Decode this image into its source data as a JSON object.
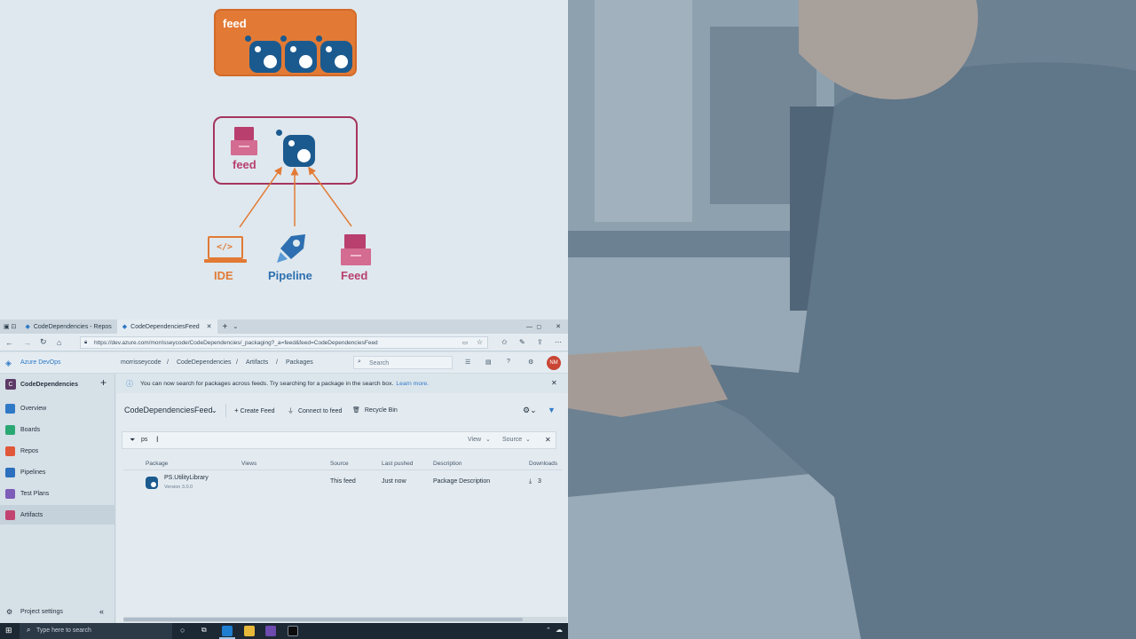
{
  "diagram": {
    "feed_box_label": "feed",
    "wrap_feed_label": "feed",
    "sources": [
      {
        "label": "IDE",
        "color": "#e27a35"
      },
      {
        "label": "Pipeline",
        "color": "#2d6fb0"
      },
      {
        "label": "Feed",
        "color": "#b83f6e"
      }
    ]
  },
  "browser": {
    "tabs": [
      {
        "label": "CodeDependencies - Repos"
      },
      {
        "label": "CodeDependenciesFeed"
      }
    ],
    "url": "https://dev.azure.com/morrisseycode/CodeDependencies/_packaging?_a=feed&feed=CodeDependenciesFeed"
  },
  "devops": {
    "brand": "Azure DevOps",
    "breadcrumb": [
      "morrisseycode",
      "/",
      "CodeDependencies",
      "/",
      "Artifacts",
      "/",
      "Packages"
    ],
    "search_placeholder": "Search",
    "avatar": "NM",
    "project_letter": "C",
    "project": "CodeDependencies",
    "add": "+",
    "nav": [
      {
        "label": "Overview",
        "color": "#2f79c6"
      },
      {
        "label": "Boards",
        "color": "#2aa873"
      },
      {
        "label": "Repos",
        "color": "#e0573a"
      },
      {
        "label": "Pipelines",
        "color": "#2c6fbe"
      },
      {
        "label": "Test Plans",
        "color": "#7e5db8"
      },
      {
        "label": "Artifacts",
        "color": "#c2436f"
      }
    ],
    "settings": "Project settings"
  },
  "main": {
    "banner_text": "You can now search for packages across feeds. Try searching for a package in the search box.",
    "banner_link": "Learn more.",
    "feed_name": "CodeDependenciesFeed",
    "actions": [
      "Create Feed",
      "Connect to feed",
      "Recycle Bin"
    ],
    "filter_value": "ps",
    "filter_view": "View",
    "filter_source": "Source",
    "columns": [
      "Package",
      "Views",
      "Source",
      "Last pushed",
      "Description",
      "Downloads"
    ],
    "rows": [
      {
        "name": "PS.UtilityLibrary",
        "version": "Version 3.0.0",
        "source": "This feed",
        "last_pushed": "Just now",
        "description": "Package Description",
        "downloads": "3"
      }
    ]
  },
  "taskbar": {
    "search_placeholder": "Type here to search"
  }
}
